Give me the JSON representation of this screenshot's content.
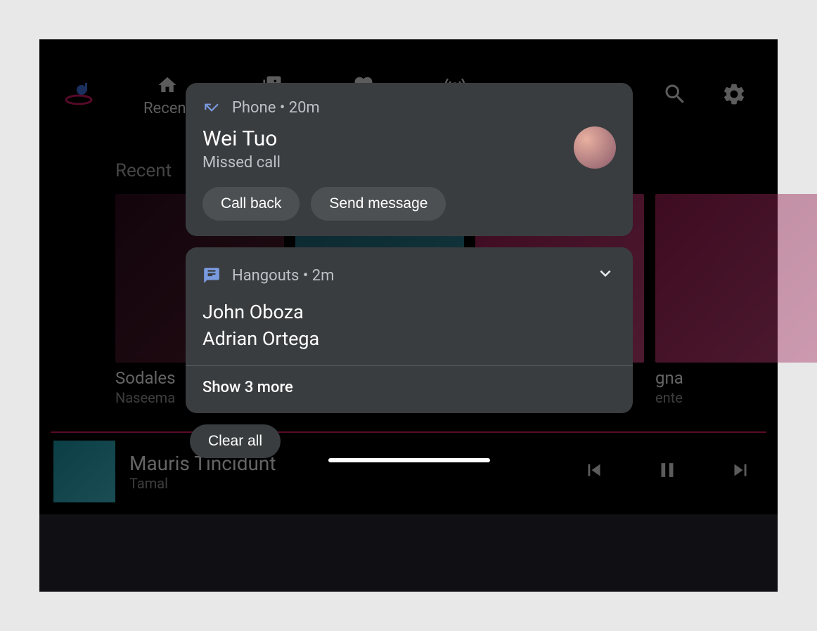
{
  "nav": {
    "tab_recent": "Recent",
    "section_title": "Recent"
  },
  "cards": [
    {
      "title": "Sodales",
      "sub": "Naseema"
    },
    {
      "title": "",
      "sub": ""
    },
    {
      "title": "gna",
      "sub": "ente"
    }
  ],
  "now_playing": {
    "title": "Mauris Tincidunt",
    "artist": "Tamal"
  },
  "notifications": {
    "phone": {
      "app": "Phone",
      "time": "20m",
      "title": "Wei Tuo",
      "subtitle": "Missed call",
      "action_call_back": "Call back",
      "action_send_message": "Send message"
    },
    "hangouts": {
      "app": "Hangouts",
      "time": "2m",
      "names": [
        "John Oboza",
        "Adrian Ortega"
      ],
      "show_more": "Show 3 more"
    },
    "clear_all": "Clear all"
  }
}
